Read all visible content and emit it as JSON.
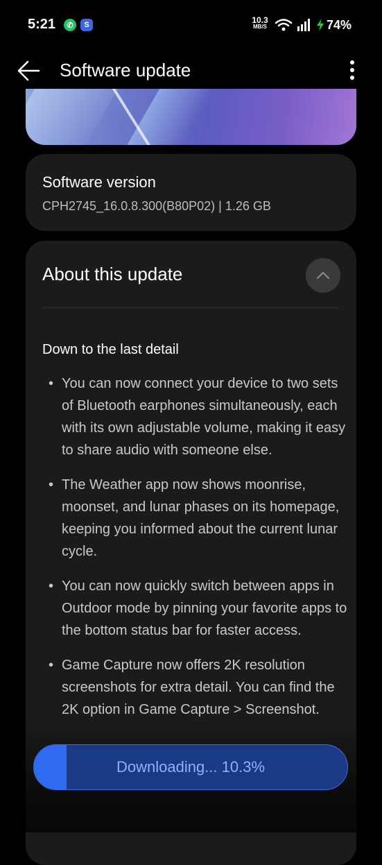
{
  "status_bar": {
    "time": "5:21",
    "net_speed_value": "10.3",
    "net_speed_unit": "MB/S",
    "battery": "74%"
  },
  "header": {
    "title": "Software update"
  },
  "version": {
    "title": "Software version",
    "detail": "CPH2745_16.0.8.300(B80P02) | 1.26 GB"
  },
  "about": {
    "title": "About this update",
    "section_heading": "Down to the last detail",
    "items": [
      "You can now connect your device to two sets of Bluetooth earphones simultaneously, each with its own adjustable volume, making it easy to share audio with someone else.",
      "The Weather app now shows moonrise, moonset, and lunar phases on its homepage, keeping you informed about the current lunar cycle.",
      "You can now quickly switch between apps in Outdoor mode by pinning your favorite apps to the bottom status bar for faster access.",
      "Game Capture now offers 2K resolution screenshots for extra detail. You can find the 2K option in Game Capture > Screenshot."
    ]
  },
  "download": {
    "label": "Downloading... 10.3%",
    "progress": 0.103
  },
  "colors": {
    "background": "#000000",
    "card": "#1b1b1b",
    "accent": "#2f6bf0"
  }
}
